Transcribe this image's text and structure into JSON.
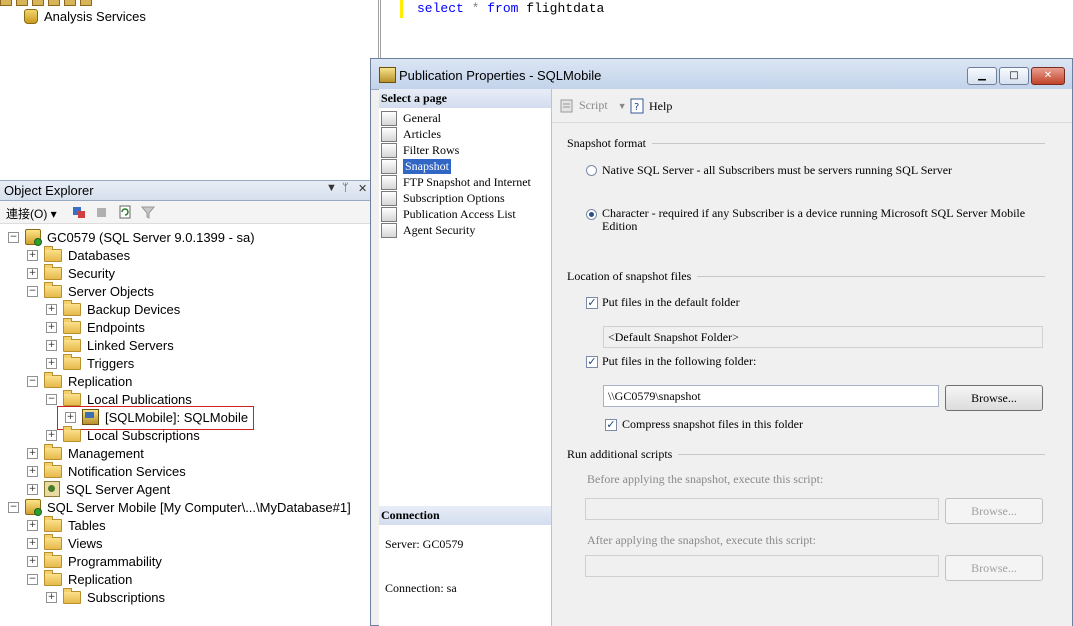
{
  "top_tree": {
    "item": "Analysis Services"
  },
  "query_editor": {
    "kw_select": "select",
    "op_star": "*",
    "kw_from": "from",
    "table": "flightdata"
  },
  "object_explorer": {
    "title": "Object Explorer",
    "connect_label": "連接(O)",
    "tree": [
      {
        "label": "GC0579 (SQL Server 9.0.1399 - sa)"
      },
      {
        "label": "Databases"
      },
      {
        "label": "Security"
      },
      {
        "label": "Server Objects"
      },
      {
        "label": "Backup Devices"
      },
      {
        "label": "Endpoints"
      },
      {
        "label": "Linked Servers"
      },
      {
        "label": "Triggers"
      },
      {
        "label": "Replication"
      },
      {
        "label": "Local Publications"
      },
      {
        "label": "[SQLMobile]: SQLMobile"
      },
      {
        "label": "Local Subscriptions"
      },
      {
        "label": "Management"
      },
      {
        "label": "Notification Services"
      },
      {
        "label": "SQL Server Agent"
      },
      {
        "label": "SQL Server Mobile [My Computer\\...\\MyDatabase#1]"
      },
      {
        "label": "Tables"
      },
      {
        "label": "Views"
      },
      {
        "label": "Programmability"
      },
      {
        "label": "Replication"
      },
      {
        "label": "Subscriptions"
      }
    ]
  },
  "dialog": {
    "title": "Publication Properties - SQLMobile",
    "select_page_header": "Select a page",
    "pages": [
      "General",
      "Articles",
      "Filter Rows",
      "Snapshot",
      "FTP Snapshot and Internet",
      "Subscription Options",
      "Publication Access List",
      "Agent Security"
    ],
    "selected_page": "Snapshot",
    "connection_header": "Connection",
    "server_text": "Server: GC0579",
    "connection_text": "Connection: sa",
    "toolbar": {
      "script": "Script",
      "help": "Help"
    },
    "snapshot_format": {
      "header": "Snapshot format",
      "native": "Native SQL Server - all Subscribers must be servers running SQL Server",
      "character_line1": "Character - required if any Subscriber is a device running Microsoft SQL Server Mobile",
      "character_line2": "Edition",
      "selected": "character"
    },
    "location": {
      "header": "Location of snapshot files",
      "default_folder_label": "Put files in the default folder",
      "default_folder_checked": true,
      "default_folder_value": "<Default Snapshot Folder>",
      "following_folder_label": "Put files in the following folder:",
      "following_folder_checked": true,
      "following_folder_value": "\\\\GC0579\\snapshot",
      "browse": "Browse...",
      "compress_label": "Compress snapshot files in this folder",
      "compress_checked": true
    },
    "scripts": {
      "header": "Run additional scripts",
      "before_label": "Before applying the snapshot, execute this script:",
      "after_label": "After applying the snapshot, execute this script:",
      "browse": "Browse..."
    }
  }
}
